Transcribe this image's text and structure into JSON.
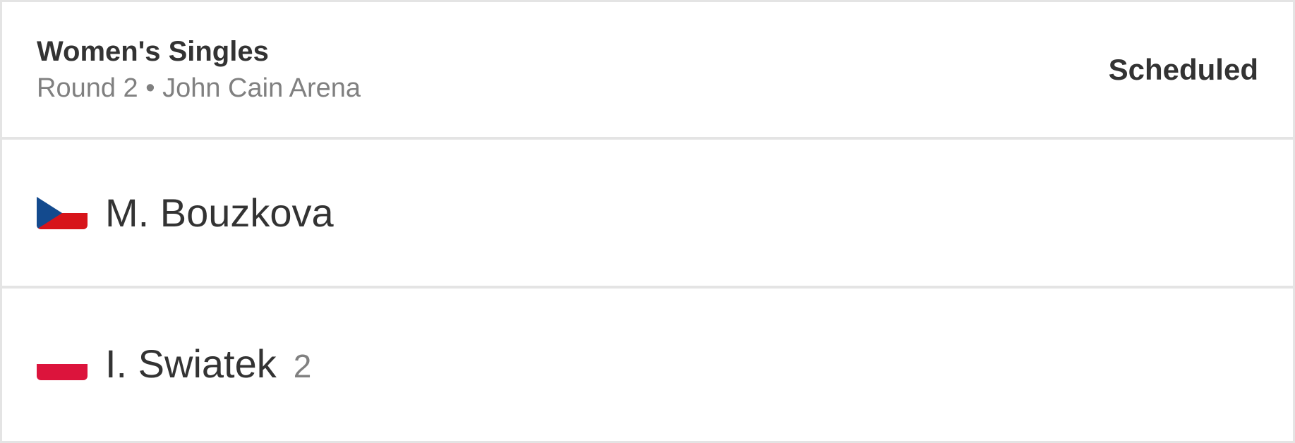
{
  "match": {
    "event": "Women's Singles",
    "details": "Round 2 • John Cain Arena",
    "status": "Scheduled"
  },
  "players": [
    {
      "name": "M. Bouzkova",
      "seed": "",
      "flag_icon": "czech-flag-icon",
      "flag_colors": {
        "blue": "#134a8e",
        "red": "#d7141a",
        "white": "#ffffff"
      }
    },
    {
      "name": "I. Swiatek",
      "seed": "2",
      "flag_icon": "poland-flag-icon",
      "flag_colors": {
        "white": "#ffffff",
        "red": "#dc143c"
      }
    }
  ],
  "colors": {
    "border": "#e4e4e4",
    "text": "#333333",
    "muted": "#808080"
  }
}
